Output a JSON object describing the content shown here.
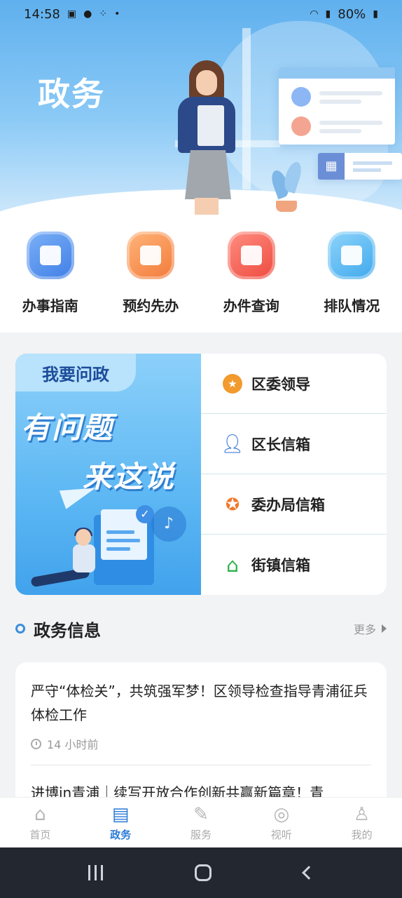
{
  "status_bar": {
    "time": "14:58",
    "battery": "80%"
  },
  "header": {
    "title": "政务"
  },
  "quick_services": [
    {
      "label": "办事指南",
      "icon": "calendar-check-icon",
      "color": "#3f7ee6"
    },
    {
      "label": "预约先办",
      "icon": "printer-icon",
      "color": "#f27a3a"
    },
    {
      "label": "办件查询",
      "icon": "document-search-icon",
      "color": "#ee4a3f"
    },
    {
      "label": "排队情况",
      "icon": "users-icon",
      "color": "#3fa9ec"
    }
  ],
  "wenzheng": {
    "tag": "我要问政",
    "slogan_line1": "有问题",
    "slogan_line2": "来这说",
    "items": [
      {
        "label": "区委领导",
        "icon": "medal-star-icon"
      },
      {
        "label": "区长信箱",
        "icon": "person-icon"
      },
      {
        "label": "委办局信箱",
        "icon": "star-swirl-icon"
      },
      {
        "label": "街镇信箱",
        "icon": "house-icon"
      }
    ]
  },
  "news_section": {
    "title": "政务信息",
    "more": "更多",
    "items": [
      {
        "title": "严守“体检关”，共筑强军梦！区领导检查指导青浦征兵体检工作",
        "time": "14 小时前"
      },
      {
        "title": "进博in青浦｜续写开放合作创新共赢新篇章！青"
      }
    ]
  },
  "tabbar": [
    {
      "label": "首页",
      "icon": "home-icon",
      "active": false
    },
    {
      "label": "政务",
      "icon": "document-edit-icon",
      "active": true
    },
    {
      "label": "服务",
      "icon": "edit-icon",
      "active": false
    },
    {
      "label": "视听",
      "icon": "compass-icon",
      "active": false
    },
    {
      "label": "我的",
      "icon": "user-icon",
      "active": false
    }
  ],
  "colors": {
    "accent": "#2a79d6",
    "header_top": "#5fb0ee",
    "divider": "#cfe7ea"
  }
}
